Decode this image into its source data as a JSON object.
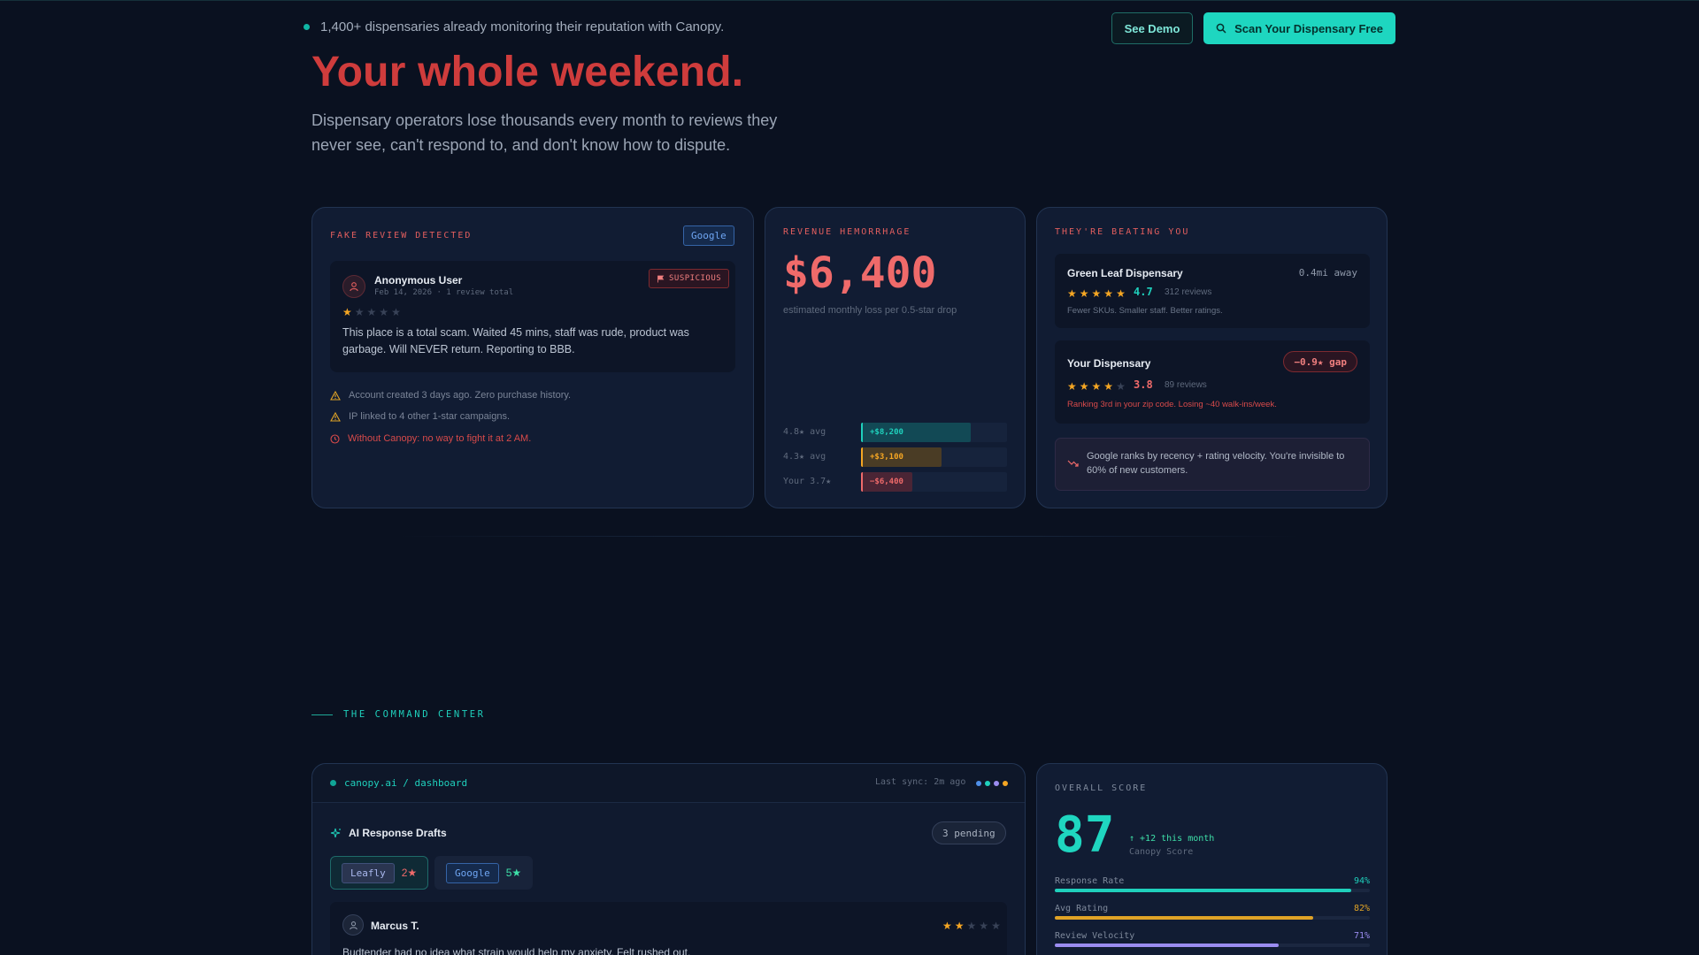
{
  "topbar": {
    "announcement": "1,400+ dispensaries already monitoring their reputation with Canopy.",
    "demo_button": "See Demo",
    "scan_button": "Scan Your Dispensary Free"
  },
  "hero": {
    "title": "Your whole weekend.",
    "subtitle": "Dispensary operators lose thousands every month to reviews they never see, can't respond to, and don't know how to dispute."
  },
  "fake_review_card": {
    "label": "FAKE REVIEW DETECTED",
    "platform": "Google",
    "reviewer": "Anonymous User",
    "meta": "Feb 14, 2026 · 1 review total",
    "badge": "SUSPICIOUS",
    "rating": 1,
    "text": "This place is a total scam. Waited 45 mins, staff was rude, product was garbage. Will NEVER return. Reporting to BBB.",
    "signals": [
      "Account created 3 days ago. Zero purchase history.",
      "IP linked to 4 other 1-star campaigns.",
      "Without Canopy: no way to fight it at 2 AM."
    ]
  },
  "revenue_card": {
    "label": "REVENUE HEMORRHAGE",
    "amount": "$6,400",
    "caption": "estimated monthly loss per 0.5-star drop",
    "bars": [
      {
        "label": "4.8★ avg",
        "value": "+$8,200",
        "fraction": 0.75,
        "color": "#1fd0bc",
        "fill": "#124955"
      },
      {
        "label": "4.3★ avg",
        "value": "+$3,100",
        "fraction": 0.55,
        "color": "#f5a623",
        "fill": "#4a3c25"
      },
      {
        "label": "Your 3.7★",
        "value": "−$6,400",
        "fraction": 0.35,
        "color": "#ef6a6a",
        "fill": "#4a2535"
      }
    ]
  },
  "competitor_card": {
    "label": "THEY'RE BEATING YOU",
    "competitor": {
      "name": "Green Leaf Dispensary",
      "distance": "0.4mi away",
      "rating": 4.7,
      "rating_text": "4.7",
      "reviews": "312 reviews",
      "note": "Fewer SKUs. Smaller staff. Better ratings."
    },
    "yours": {
      "name": "Your Dispensary",
      "gap": "−0.9★ gap",
      "rating": 3.8,
      "rating_text": "3.8",
      "reviews": "89 reviews",
      "note": "Ranking 3rd in your zip code. Losing ~40 walk-ins/week."
    },
    "insight": "Google ranks by recency + rating velocity. You're invisible to 60% of new customers."
  },
  "command_center": {
    "section_label": "THE COMMAND CENTER",
    "dashboard": {
      "crumb": "canopy.ai / dashboard",
      "sync": "Last sync: 2m ago",
      "drafts_title": "AI Response Drafts",
      "pending": "3 pending",
      "tabs": [
        {
          "tag": "Leafly",
          "count": "2★"
        },
        {
          "tag": "Google",
          "count": "5★"
        }
      ],
      "draft": {
        "name": "Marcus T.",
        "rating": 2,
        "text": "Budtender had no idea what strain would help my anxiety. Felt rushed out."
      }
    },
    "score": {
      "label": "OVERALL SCORE",
      "value": "87",
      "delta": "↑ +12 this month",
      "sub": "Canopy Score",
      "metrics": [
        {
          "label": "Response Rate",
          "value": "94%",
          "fraction": 0.94,
          "color": "#1fd0bc"
        },
        {
          "label": "Avg Rating",
          "value": "82%",
          "fraction": 0.82,
          "color": "#e0a326"
        },
        {
          "label": "Review Velocity",
          "value": "71%",
          "fraction": 0.71,
          "color": "#9b8cf0"
        }
      ]
    }
  },
  "colors": {
    "accent": "#1ed6c0",
    "danger": "#cf3c3c",
    "warning": "#f5a623"
  }
}
